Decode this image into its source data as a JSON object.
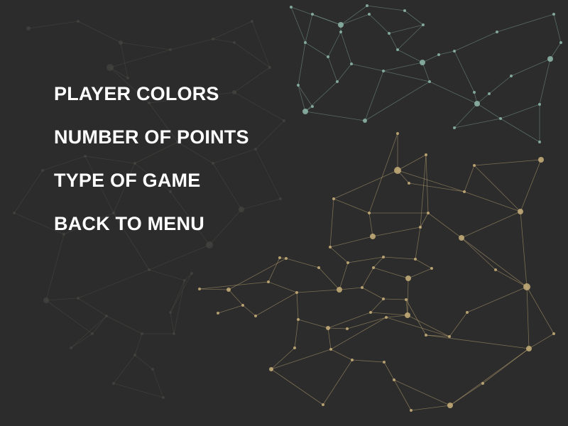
{
  "menu": {
    "items": [
      {
        "id": "player-colors",
        "label": "PLAYER COLORS"
      },
      {
        "id": "number-of-points",
        "label": "NUMBER OF POINTS"
      },
      {
        "id": "type-of-game",
        "label": "TYPE OF GAME"
      },
      {
        "id": "back-to-menu",
        "label": "BACK TO MENU"
      }
    ]
  },
  "colors": {
    "background": "#2c2c2c",
    "text": "#ffffff",
    "network_teal": "#8fb8ac",
    "network_gold": "#c9b07a",
    "network_faint": "#4a4a46"
  }
}
